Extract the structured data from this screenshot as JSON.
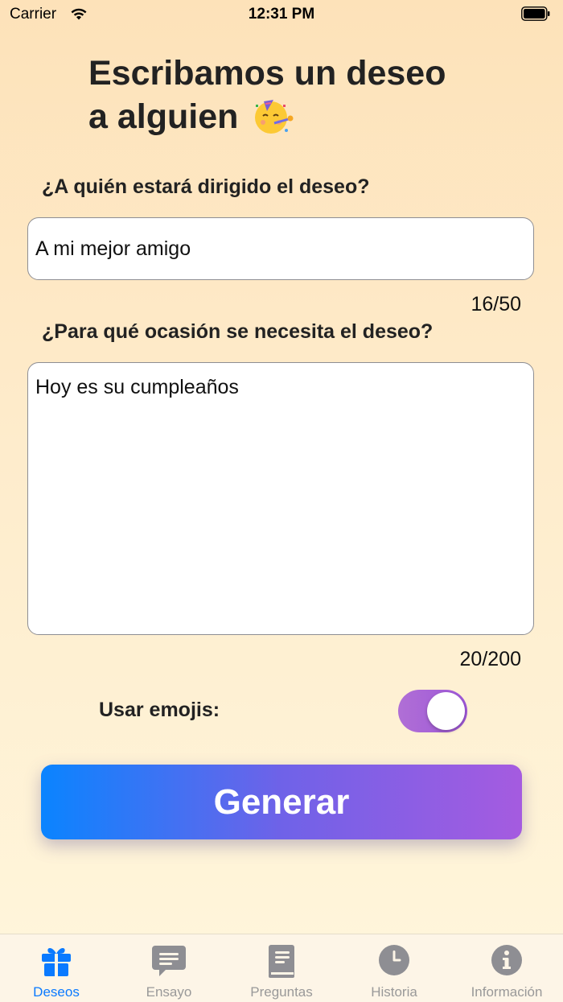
{
  "status_bar": {
    "carrier": "Carrier",
    "time": "12:31 PM"
  },
  "header": {
    "title_line1": "Escribamos un deseo",
    "title_line2": "a alguien"
  },
  "form": {
    "recipient": {
      "label": "¿A quién estará dirigido el deseo?",
      "value": "A mi mejor amigo",
      "counter": "16/50"
    },
    "occasion": {
      "label": "¿Para qué ocasión se necesita el deseo?",
      "value": "Hoy es su cumpleaños",
      "counter": "20/200"
    },
    "emojis": {
      "label": "Usar emojis:",
      "enabled": true
    },
    "generate_label": "Generar"
  },
  "tabs": [
    {
      "label": "Deseos",
      "icon": "gift-icon",
      "active": true
    },
    {
      "label": "Ensayo",
      "icon": "message-icon",
      "active": false
    },
    {
      "label": "Preguntas",
      "icon": "book-icon",
      "active": false
    },
    {
      "label": "Historia",
      "icon": "clock-icon",
      "active": false
    },
    {
      "label": "Información",
      "icon": "info-icon",
      "active": false
    }
  ],
  "colors": {
    "accent": "#0a7aff",
    "toggle": "#a862d8",
    "button_start": "#0a84ff",
    "button_end": "#a55be0",
    "inactive_tab": "#999999"
  }
}
